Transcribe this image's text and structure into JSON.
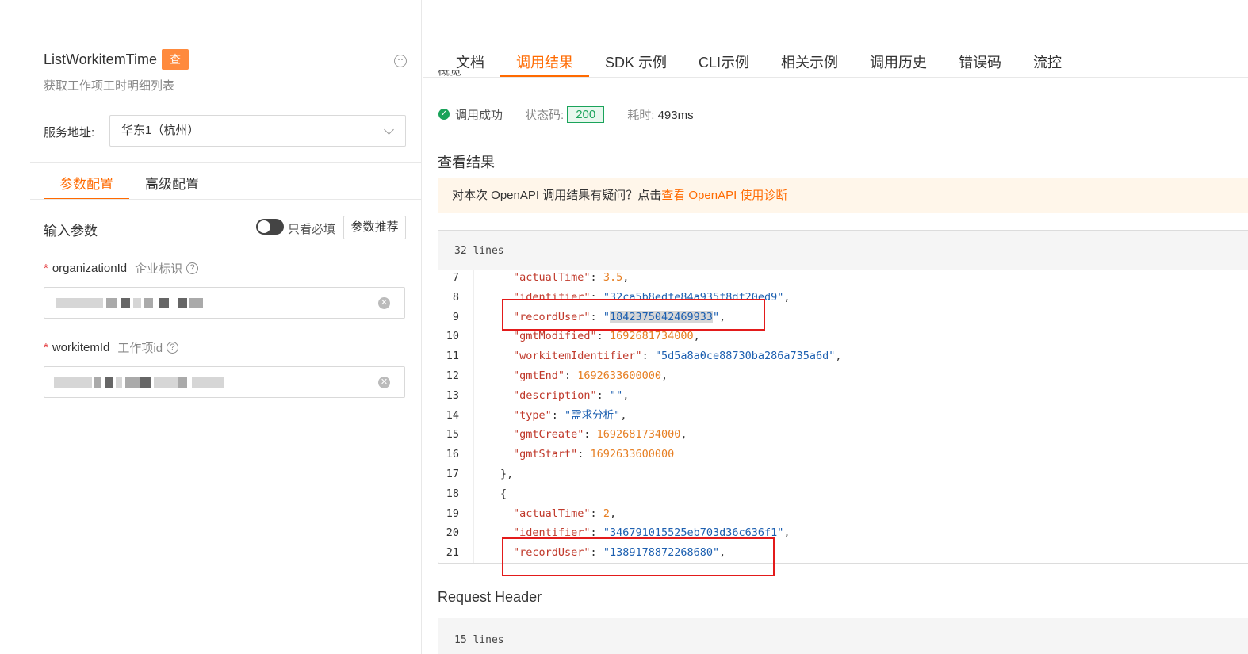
{
  "left": {
    "api_name": "ListWorkitemTime",
    "api_badge": "查",
    "api_desc": "获取工作项工时明细列表",
    "service_label": "服务地址:",
    "service_value": "华东1（杭州）",
    "config_tabs": [
      "参数配置",
      "高级配置"
    ],
    "input_params_label": "输入参数",
    "only_required_label": "只看必填",
    "recommend_button": "参数推荐",
    "params": [
      {
        "name": "organizationId",
        "cn": "企业标识",
        "required": "*"
      },
      {
        "name": "workitemId",
        "cn": "工作项id",
        "required": "*"
      }
    ],
    "help_glyph": "?"
  },
  "right": {
    "tabs": [
      "文档",
      "调用结果",
      "SDK 示例",
      "CLI示例",
      "相关示例",
      "调用历史",
      "错误码",
      "流控"
    ],
    "active_tab": "调用结果",
    "overview_cut": "概览",
    "status": {
      "success_text": "调用成功",
      "code_label": "状态码:",
      "code_value": "200",
      "elapsed_label": "耗时:",
      "elapsed_value": "493ms"
    },
    "result_title": "查看结果",
    "tip_text": "对本次 OpenAPI 调用结果有疑问？点击",
    "tip_link": "查看 OpenAPI 使用诊断",
    "result_lines_count": "32 lines",
    "request_header_title": "Request Header",
    "request_lines_count": "15 lines"
  },
  "code_lines": [
    {
      "n": "7",
      "indent": "  ",
      "parts": [
        [
          "k",
          "\"actualTime\""
        ],
        [
          "p",
          ": "
        ],
        [
          "n",
          "3.5"
        ],
        [
          "p",
          ","
        ]
      ]
    },
    {
      "n": "8",
      "indent": "  ",
      "parts": [
        [
          "k",
          "\"identifier\""
        ],
        [
          "p",
          ": "
        ],
        [
          "s",
          "\"32ca5b8edfe84a935f8df20ed9\""
        ],
        [
          "p",
          ","
        ]
      ]
    },
    {
      "n": "9",
      "indent": "  ",
      "parts": [
        [
          "k",
          "\"recordUser\""
        ],
        [
          "p",
          ": "
        ],
        [
          "s",
          "\""
        ],
        [
          "sh",
          "1842375042469933"
        ],
        [
          "s",
          "\""
        ],
        [
          "p",
          ","
        ]
      ]
    },
    {
      "n": "10",
      "indent": "  ",
      "parts": [
        [
          "k",
          "\"gmtModified\""
        ],
        [
          "p",
          ": "
        ],
        [
          "n",
          "1692681734000"
        ],
        [
          "p",
          ","
        ]
      ]
    },
    {
      "n": "11",
      "indent": "  ",
      "parts": [
        [
          "k",
          "\"workitemIdentifier\""
        ],
        [
          "p",
          ": "
        ],
        [
          "s",
          "\"5d5a8a0ce88730ba286a735a6d\""
        ],
        [
          "p",
          ","
        ]
      ]
    },
    {
      "n": "12",
      "indent": "  ",
      "parts": [
        [
          "k",
          "\"gmtEnd\""
        ],
        [
          "p",
          ": "
        ],
        [
          "n",
          "1692633600000"
        ],
        [
          "p",
          ","
        ]
      ]
    },
    {
      "n": "13",
      "indent": "  ",
      "parts": [
        [
          "k",
          "\"description\""
        ],
        [
          "p",
          ": "
        ],
        [
          "s",
          "\"\""
        ],
        [
          "p",
          ","
        ]
      ]
    },
    {
      "n": "14",
      "indent": "  ",
      "parts": [
        [
          "k",
          "\"type\""
        ],
        [
          "p",
          ": "
        ],
        [
          "s",
          "\"需求分析\""
        ],
        [
          "p",
          ","
        ]
      ]
    },
    {
      "n": "15",
      "indent": "  ",
      "parts": [
        [
          "k",
          "\"gmtCreate\""
        ],
        [
          "p",
          ": "
        ],
        [
          "n",
          "1692681734000"
        ],
        [
          "p",
          ","
        ]
      ]
    },
    {
      "n": "16",
      "indent": "  ",
      "parts": [
        [
          "k",
          "\"gmtStart\""
        ],
        [
          "p",
          ": "
        ],
        [
          "n",
          "1692633600000"
        ]
      ]
    },
    {
      "n": "17",
      "indent": "",
      "parts": [
        [
          "p",
          "},"
        ]
      ]
    },
    {
      "n": "18",
      "indent": "",
      "parts": [
        [
          "p",
          "{"
        ]
      ]
    },
    {
      "n": "19",
      "indent": "  ",
      "parts": [
        [
          "k",
          "\"actualTime\""
        ],
        [
          "p",
          ": "
        ],
        [
          "n",
          "2"
        ],
        [
          "p",
          ","
        ]
      ]
    },
    {
      "n": "20",
      "indent": "  ",
      "parts": [
        [
          "k",
          "\"identifier\""
        ],
        [
          "p",
          ": "
        ],
        [
          "s",
          "\"346791015525eb703d36c636f1\""
        ],
        [
          "p",
          ","
        ]
      ]
    },
    {
      "n": "21",
      "indent": "  ",
      "parts": [
        [
          "k",
          "\"recordUser\""
        ],
        [
          "p",
          ": "
        ],
        [
          "s",
          "\"1389178872268680\""
        ],
        [
          "p",
          ","
        ]
      ]
    }
  ],
  "colors": {
    "accent": "#ff6a00",
    "success": "#1aa35a",
    "json_key": "#c0392b",
    "json_string": "#1c5fb0",
    "json_number": "#e67e22",
    "annotation": "#e31b1b"
  }
}
